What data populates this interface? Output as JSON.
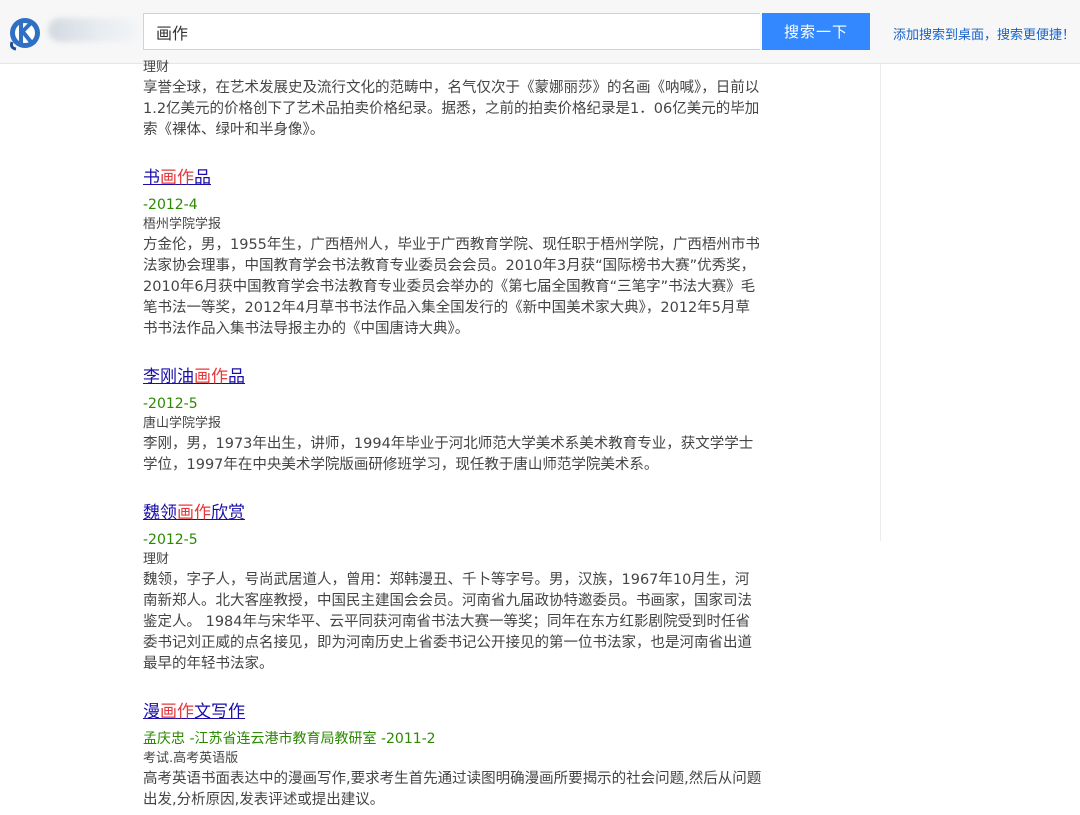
{
  "header": {
    "search_value": "画作",
    "search_button": "搜索一下",
    "add_to_desktop": "添加搜索到桌面，搜索更便捷！"
  },
  "results": [
    {
      "title_parts": [],
      "date": "",
      "source": "理财",
      "desc": "享誉全球，在艺术发展史及流行文化的范畴中，名气仅次于《蒙娜丽莎》的名画《呐喊》，日前以1.2亿美元的价格创下了艺术品拍卖价格纪录。据悉，之前的拍卖价格纪录是1．06亿美元的毕加索《裸体、绿叶和半身像》。"
    },
    {
      "title_parts": [
        "书",
        "画作",
        "品"
      ],
      "date": "-2012-4",
      "source": "梧州学院学报",
      "desc": "方金伦，男，1955年生，广西梧州人，毕业于广西教育学院、现任职于梧州学院，广西梧州市书法家协会理事，中国教育学会书法教育专业委员会会员。2010年3月获“国际榜书大赛”优秀奖，2010年6月获中国教育学会书法教育专业委员会举办的《第七届全国教育“三笔字”书法大赛》毛笔书法一等奖，2012年4月草书书法作品入集全国发行的《新中国美术家大典》，2012年5月草书书法作品入集书法导报主办的《中国唐诗大典》。"
    },
    {
      "title_parts": [
        "李刚油",
        "画作",
        "品"
      ],
      "date": "-2012-5",
      "source": "唐山学院学报",
      "desc": "李刚，男，1973年出生，讲师，1994年毕业于河北师范大学美术系美术教育专业，获文学学士学位，1997年在中央美术学院版画研修班学习，现任教于唐山师范学院美术系。"
    },
    {
      "title_parts": [
        "魏领",
        "画作",
        "欣赏"
      ],
      "date": "-2012-5",
      "source": "理财",
      "desc": "魏领，字子人，号尚武居道人，曾用：郑韩漫丑、千卜等字号。男，汉族，1967年10月生，河南新郑人。北大客座教授，中国民主建国会会员。河南省九届政协特邀委员。书画家，国家司法鉴定人。 1984年与宋华平、云平同获河南省书法大赛一等奖；同年在东方红影剧院受到时任省委书记刘正威的点名接见，即为河南历史上省委书记公开接见的第一位书法家，也是河南省出道最早的年轻书法家。"
    },
    {
      "title_parts": [
        "漫",
        "画作",
        "文写作"
      ],
      "date": "孟庆忠 -江苏省连云港市教育局教研室 -2011-2",
      "source": "考试.高考英语版",
      "desc": "高考英语书面表达中的漫画写作,要求考生首先通过读图明确漫画所要揭示的社会问题,然后从问题出发,分析原因,发表评述或提出建议。"
    }
  ]
}
